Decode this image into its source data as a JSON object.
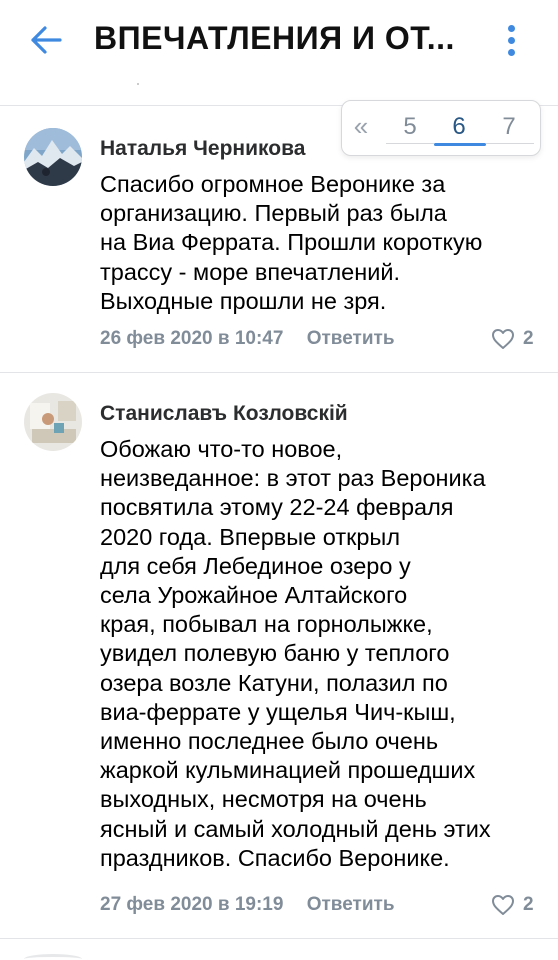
{
  "header": {
    "title": "ВПЕЧАТЛЕНИЯ И ОТ...",
    "back_icon": "arrow-left-icon",
    "menu_icon": "more-vertical-icon",
    "accent": "#3f8ae0"
  },
  "pagination": {
    "prev_label": "«",
    "pages": [
      "5",
      "6",
      "7"
    ],
    "current": "6"
  },
  "comments": [
    {
      "author": "Наталья Черникова",
      "lines": [
        "Спасибо огромное Веронике за",
        "организацию. Первый раз была",
        "на Виа Феррата. Прошли короткую",
        "трассу - море впечатлений.",
        "Выходные прошли не зря."
      ],
      "date": "26 фев 2020 в 10:47",
      "reply_label": "Ответить",
      "likes": "2"
    },
    {
      "author": "Станиславъ Козловскiй",
      "lines": [
        "Обожаю что-то новое,",
        "неизведанное: в этот раз Вероника",
        "посвятила этому 22-24 февраля",
        "2020 года. Впервые открыл",
        "для себя Лебединое озеро у",
        "села Урожайное Алтайского",
        "края, побывал на горнолыжке,",
        "увидел полевую баню у теплого",
        "озера возле Катуни, полазил по",
        "виа-феррате у ущелья Чич-кыш,",
        "именно последнее было очень",
        "жаркой кульминацией прошедших",
        "выходных, несмотря на очень",
        "ясный и самый холодный день этих",
        "праздников. Спасибо Веронике."
      ],
      "date": "27 фев 2020 в 19:19",
      "reply_label": "Ответить",
      "likes": "2"
    }
  ]
}
